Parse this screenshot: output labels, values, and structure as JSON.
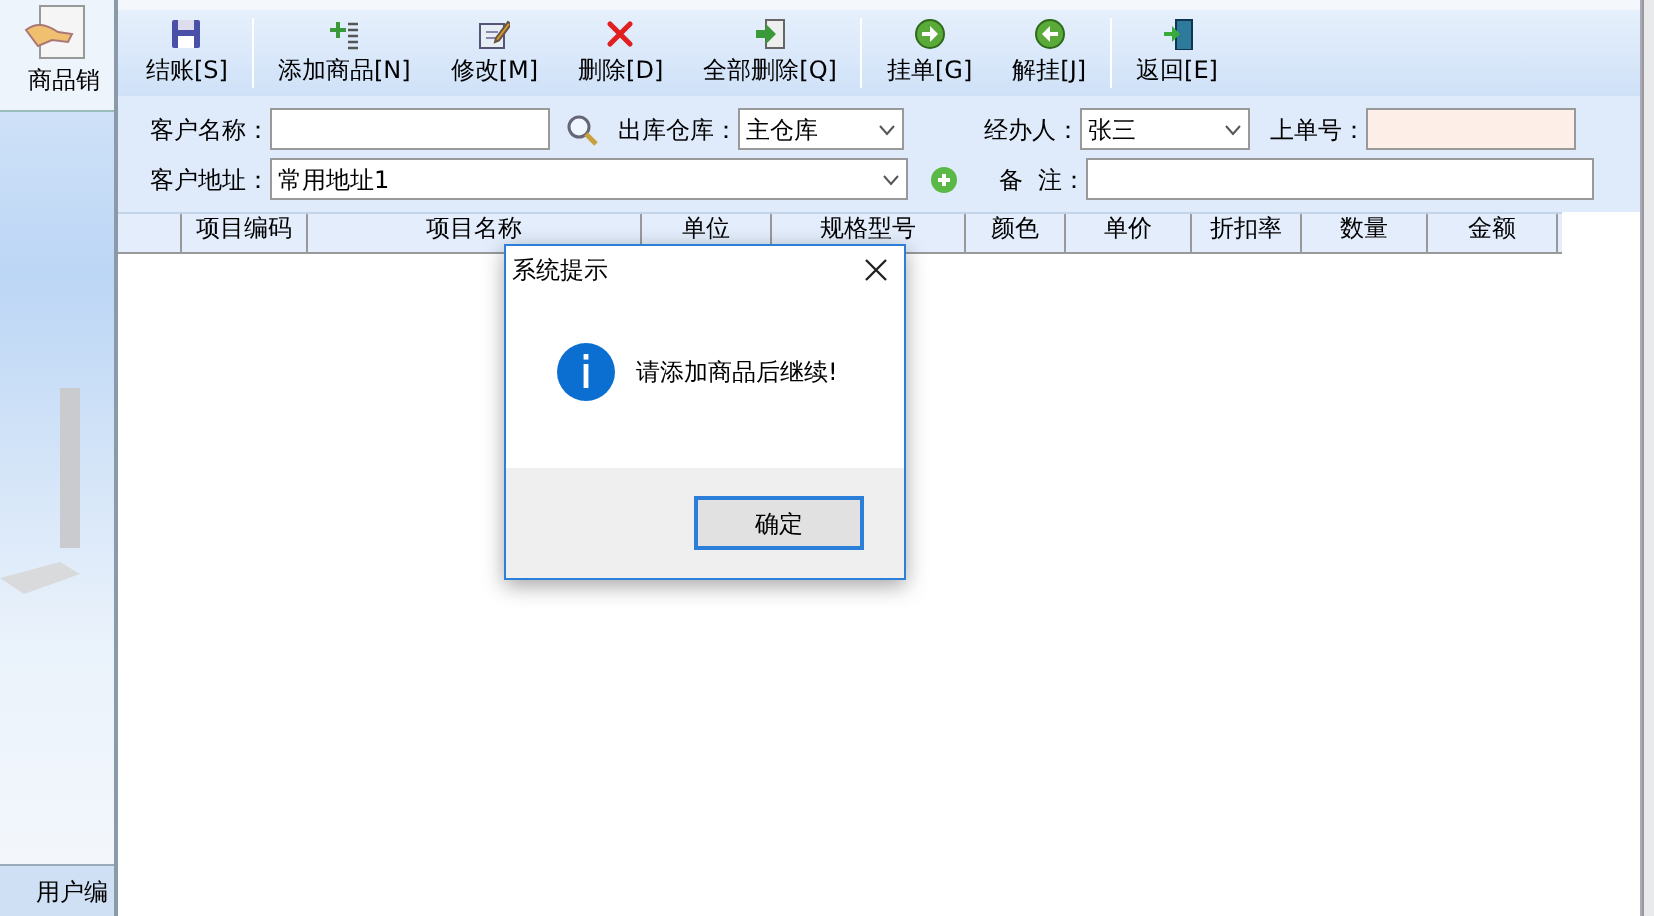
{
  "sidebar": {
    "items": [
      {
        "label": "商品销"
      }
    ],
    "footer": "用户编"
  },
  "toolbar": [
    {
      "label": "结账[S]",
      "kind": "save",
      "separator_after": true
    },
    {
      "label": "添加商品[N]",
      "kind": "add",
      "separator_after": false
    },
    {
      "label": "修改[M]",
      "kind": "edit",
      "separator_after": false
    },
    {
      "label": "删除[D]",
      "kind": "delete",
      "separator_after": false
    },
    {
      "label": "全部删除[Q]",
      "kind": "delete-all",
      "separator_after": true
    },
    {
      "label": "挂单[G]",
      "kind": "hold",
      "separator_after": false
    },
    {
      "label": "解挂[J]",
      "kind": "release",
      "separator_after": true
    },
    {
      "label": "返回[E]",
      "kind": "exit",
      "separator_after": false
    }
  ],
  "form": {
    "customer_name": {
      "label": "客户名称："
    },
    "warehouse": {
      "label": "出库仓库：",
      "value": "主仓库"
    },
    "handler": {
      "label": "经办人：",
      "value": "张三"
    },
    "previous_order": {
      "label": "上单号："
    },
    "address": {
      "label": "客户地址：",
      "value": "常用地址1"
    },
    "remark": {
      "label": "备  注："
    }
  },
  "table": {
    "columns": [
      "项目编码",
      "项目名称",
      "单位",
      "规格型号",
      "颜色",
      "单价",
      "折扣率",
      "数量",
      "金额"
    ]
  },
  "dialog": {
    "title": "系统提示",
    "message": "请添加商品后继续!",
    "button": "确定"
  }
}
